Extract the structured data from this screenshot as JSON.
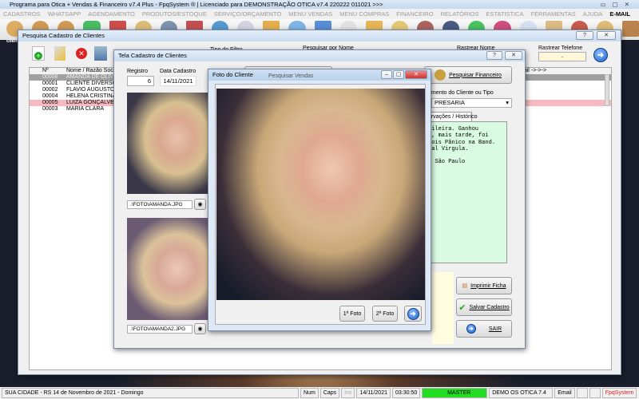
{
  "app": {
    "title": "Programa para Otica + Vendas & Financeiro v7.4 Plus - FpqSystem ® | Licenciado para  DEMONSTRAÇÃO OTICA v7.4 220222 011021 >>>"
  },
  "menu": [
    "CADASTROS",
    "WHATSAPP",
    "AGENDAMENTO",
    "PRODUTOS/ESTOQUE",
    "SERVIÇO/ORÇAMENTO",
    "MENU VENDAS",
    "MENU COMPRAS",
    "FINANCEIRO",
    "RELATÓRIOS",
    "ESTATISTICA",
    "FERRAMENTAS",
    "AJUDA",
    "E-MAIL"
  ],
  "toolbar": {
    "first_label": "clien"
  },
  "search_window": {
    "title": "Pesquisa Cadastro de Clientes",
    "filter_type_label": "Tipo do Filtro",
    "search_name_label": "Pesquisar por Nome",
    "track_name_label": "Rastrear Nome",
    "track_phone_label": "Rastrear Telefone",
    "track_phone_value": "-",
    "columns": [
      "Nº",
      "Nome / Razão Social"
    ],
    "right_column": "mail ->->->",
    "rows": [
      {
        "num": "00006",
        "name": "AMANDA DE OLIVEIRA QUEIROZ",
        "state": "selected"
      },
      {
        "num": "00001",
        "name": "CLIENTE DIVERSOS",
        "state": ""
      },
      {
        "num": "00002",
        "name": "FLAVIO AUGUSTO DA SILVA",
        "state": ""
      },
      {
        "num": "00004",
        "name": "HELENA CRISTINA",
        "state": ""
      },
      {
        "num": "00005",
        "name": "LUIZA GONÇALVES",
        "state": "pink"
      },
      {
        "num": "00003",
        "name": "MARIA CLARA",
        "state": ""
      }
    ]
  },
  "cadastro_window": {
    "title": "Tela Cadastro de Clientes",
    "registro_label": "Registro",
    "registro_value": "6",
    "data_label": "Data Cadastro",
    "data_value": "14/11/2021",
    "photo1_path": ".\\FOTO\\AMANDA.JPG",
    "photo2_path": ".\\FOTO\\AMANDA2.JPG",
    "search_sales": "Pesquisar Vendas",
    "search_finance": "Pesquisar Financeiro",
    "segment_label": "mento do Cliente ou Tipo",
    "segment_value": "PRESARIA",
    "tab_label": "ervações / Histórico",
    "notes": [
      "sileira. Ganhou",
      "e, mais tarde, foi",
      "pois Pânico na Band.",
      "tal Virgula.",
      "",
      ", São Paulo"
    ],
    "print_button": "Imprimir Ficha",
    "save_button": "Salvar Cadastro",
    "exit_button": "SAIR"
  },
  "photo_window": {
    "title": "Foto do Cliente",
    "photo1_button": "1ª Foto",
    "photo2_button": "2ª Foto"
  },
  "statusbar": {
    "city_date": "SUA CIDADE - RS 14 de Novembro de 2021 - Domingo",
    "num": "Num",
    "caps": "Caps",
    "ins": "Ins",
    "date": "14/11/2021",
    "time": "03:30:50",
    "user": "MASTER",
    "version": "DEMO OS OTICA 7.4",
    "email": "Email",
    "brand": "FpqSystem"
  },
  "colors": {
    "selected_row": "#a0a0a0",
    "pink_row": "#f7b9be",
    "notes_bg": "#d9fbe2",
    "status_user": "#22dd22"
  }
}
